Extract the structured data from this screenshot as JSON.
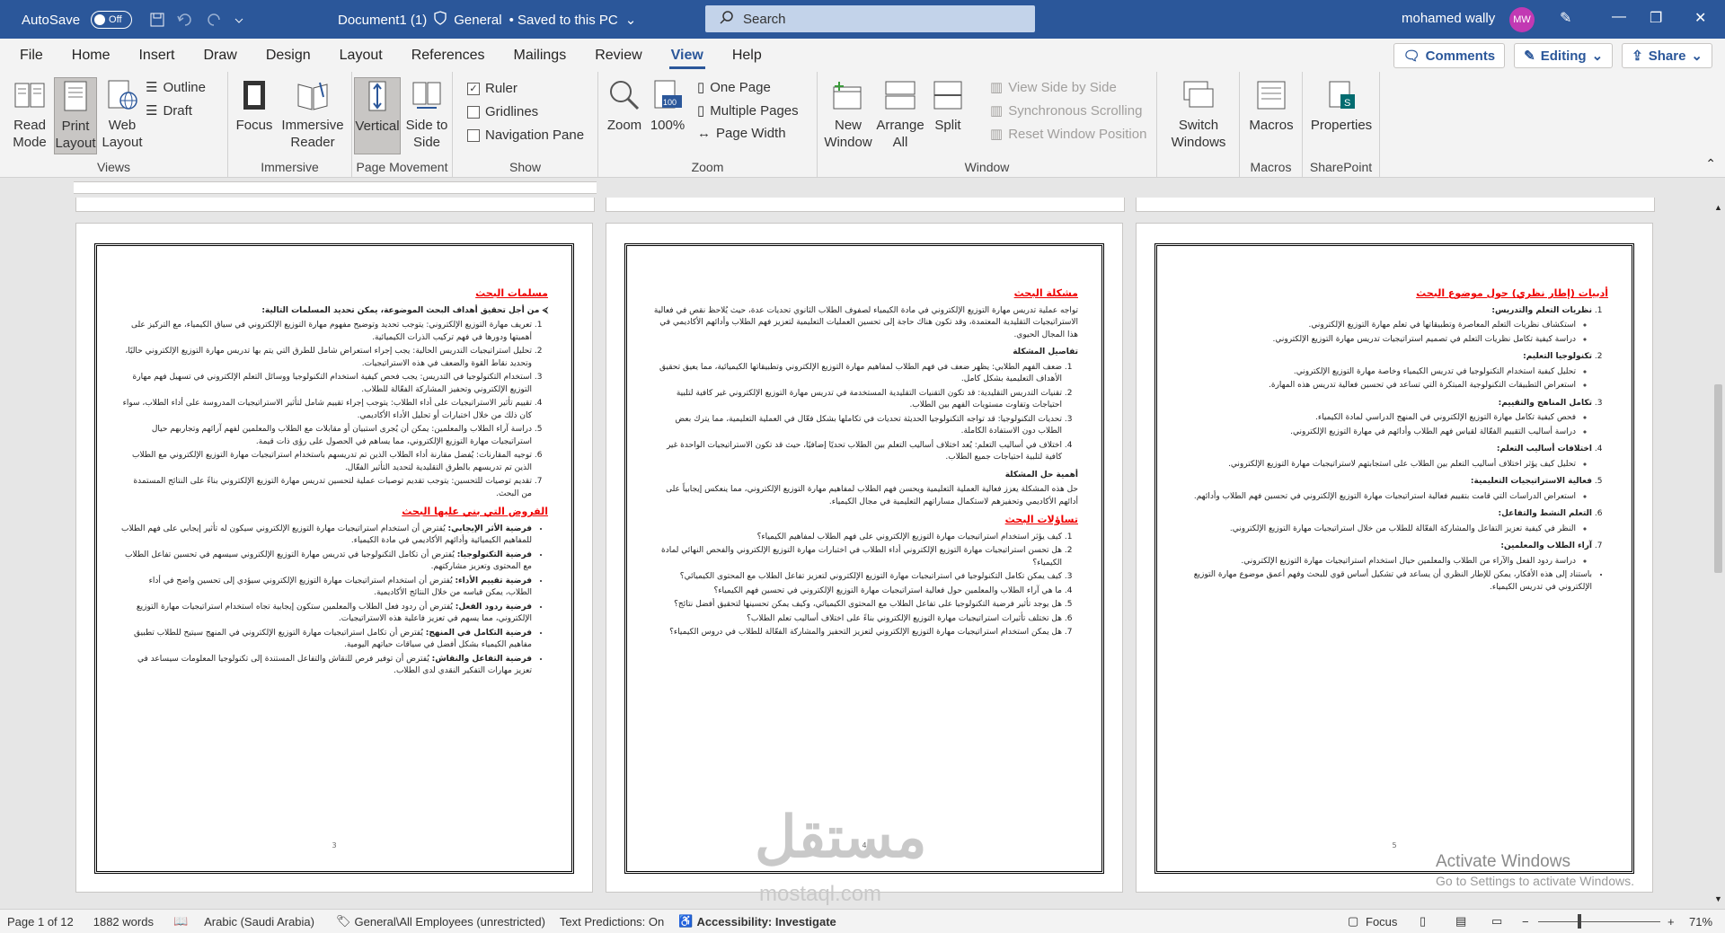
{
  "titlebar": {
    "autosave_label": "AutoSave",
    "autosave_state": "Off",
    "doc_title": "Document1 (1)",
    "sensitivity": "General",
    "save_state": "• Saved to this PC",
    "search_placeholder": "Search",
    "user_name": "mohamed wally",
    "user_initials": "MW"
  },
  "menu": {
    "tabs": [
      "File",
      "Home",
      "Insert",
      "Draw",
      "Design",
      "Layout",
      "References",
      "Mailings",
      "Review",
      "View",
      "Help"
    ],
    "active_tab": "View",
    "comments_label": "Comments",
    "editing_label": "Editing",
    "share_label": "Share"
  },
  "ribbon": {
    "views": {
      "label": "Views",
      "read_mode": "Read Mode",
      "print_layout": "Print Layout",
      "web_layout": "Web Layout",
      "outline": "Outline",
      "draft": "Draft"
    },
    "immersive": {
      "label": "Immersive",
      "focus": "Focus",
      "immersive_reader": "Immersive Reader"
    },
    "page_movement": {
      "label": "Page Movement",
      "vertical": "Vertical",
      "side_to_side": "Side to Side"
    },
    "show": {
      "label": "Show",
      "ruler": "Ruler",
      "gridlines": "Gridlines",
      "navigation_pane": "Navigation Pane",
      "ruler_checked": true
    },
    "zoom": {
      "label": "Zoom",
      "zoom": "Zoom",
      "hundred": "100%",
      "one_page": "One Page",
      "multiple_pages": "Multiple Pages",
      "page_width": "Page Width"
    },
    "window": {
      "label": "Window",
      "new_window": "New Window",
      "arrange_all": "Arrange All",
      "split": "Split",
      "view_side_by_side": "View Side by Side",
      "sync_scrolling": "Synchronous Scrolling",
      "reset_position": "Reset Window Position",
      "switch_windows": "Switch Windows"
    },
    "macros": {
      "label": "Macros",
      "macros": "Macros"
    },
    "sharepoint": {
      "label": "SharePoint",
      "properties": "Properties"
    }
  },
  "pages": {
    "p3": {
      "number": "3",
      "h1": "مسلمات البحث",
      "intro": "من أجل تحقيق أهداف البحث الموضوعة، يمكن تحديد المسلمات التالية:",
      "items": [
        "تعريف مهارة التوزيع الإلكتروني: يتوجب تحديد وتوضيح مفهوم مهارة التوزيع الإلكتروني في سياق الكيمياء، مع التركيز على أهميتها ودورها في فهم تركيب الذرات الكيميائية.",
        "تحليل استراتيجيات التدريس الحالية: يجب إجراء استعراض شامل للطرق التي يتم بها تدريس مهارة التوزيع الإلكتروني حاليًا، وتحديد نقاط القوة والضعف في هذه الاستراتيجيات.",
        "استخدام التكنولوجيا في التدريس: يجب فحص كيفية استخدام التكنولوجيا ووسائل التعلم الإلكتروني في تسهيل فهم مهارة التوزيع الإلكتروني وتحفيز المشاركة الفعّالة للطلاب.",
        "تقييم تأثير الاستراتيجيات على أداء الطلاب: يتوجب إجراء تقييم شامل لتأثير الاستراتيجيات المدروسة على أداء الطلاب، سواء كان ذلك من خلال اختبارات أو تحليل الأداء الأكاديمي.",
        "دراسة آراء الطلاب والمعلمين: يمكن أن يُجرى استبيان أو مقابلات مع الطلاب والمعلمين لفهم آرائهم وتجاربهم حيال استراتيجيات مهارة التوزيع الإلكتروني، مما يساهم في الحصول على رؤى ذات قيمة.",
        "توجيه المقارنات: يُفضل مقارنة أداء الطلاب الذين تم تدريسهم باستخدام استراتيجيات مهارة التوزيع الإلكتروني مع الطلاب الذين تم تدريسهم بالطرق التقليدية لتحديد التأثير الفعّال.",
        "تقديم توصيات للتحسين: يتوجب تقديم توصيات عملية لتحسين تدريس مهارة التوزيع الإلكتروني بناءً على النتائج المستمدة من البحث."
      ],
      "h2": "الفروض التي بني عليها البحث",
      "hyp": [
        {
          "b": "فرضية الأثر الإيجابي:",
          "t": " يُفترض أن استخدام استراتيجيات مهارة التوزيع الإلكتروني سيكون له تأثير إيجابي على فهم الطلاب للمفاهيم الكيميائية وأدائهم الأكاديمي في مادة الكيمياء."
        },
        {
          "b": "فرضية التكنولوجيا:",
          "t": " يُفترض أن تكامل التكنولوجيا في تدريس مهارة التوزيع الإلكتروني سيسهم في تحسين تفاعل الطلاب مع المحتوى وتعزيز مشاركتهم."
        },
        {
          "b": "فرضية تقييم الأداء:",
          "t": " يُفترض أن استخدام استراتيجيات مهارة التوزيع الإلكتروني سيؤدي إلى تحسين واضح في أداء الطلاب، يمكن قياسه من خلال النتائج الأكاديمية."
        },
        {
          "b": "فرضية ردود الفعل:",
          "t": " يُفترض أن ردود فعل الطلاب والمعلمين ستكون إيجابية تجاه استخدام استراتيجيات مهارة التوزيع الإلكتروني، مما يسهم في تعزيز فاعلية هذه الاستراتيجيات."
        },
        {
          "b": "فرضية التكامل في المنهج:",
          "t": " يُفترض أن تكامل استراتيجيات مهارة التوزيع الإلكتروني في المنهج سيتيح للطلاب تطبيق مفاهيم الكيمياء بشكل أفضل في سياقات حياتهم اليومية."
        },
        {
          "b": "فرضية التفاعل والنقاش:",
          "t": " يُفترض أن توفير فرص للنقاش والتفاعل المستندة إلى تكنولوجيا المعلومات سيساعد في تعزيز مهارات التفكير النقدي لدى الطلاب."
        }
      ]
    },
    "p4": {
      "number": "4",
      "h1": "مشكلة البحث",
      "intro": "تواجه عملية تدريس مهارة التوزيع الإلكتروني في مادة الكيمياء لصفوف الطلاب الثانوي تحديات عدة، حيث يُلاحظ نقص في فعالية الاستراتيجيات التقليدية المعتمدة، وقد تكون هناك حاجة إلى تحسين العمليات التعليمية لتعزيز فهم الطلاب وأدائهم الأكاديمي في هذا المجال الحيوي.",
      "sh1": "تفاصيل المشكلة",
      "items": [
        "ضعف الفهم الطلابي: يظهر ضعف في فهم الطلاب لمفاهيم مهارة التوزيع الإلكتروني وتطبيقاتها الكيميائية، مما يعيق تحقيق الأهداف التعليمية بشكل كامل.",
        "تقنيات التدريس التقليدية: قد تكون التقنيات التقليدية المستخدمة في تدريس مهارة التوزيع الإلكتروني غير كافية لتلبية احتياجات وتفاوت مستويات الفهم بين الطلاب.",
        "تحديات التكنولوجيا: قد تواجه التكنولوجيا الحديثة تحديات في تكاملها بشكل فعّال في العملية التعليمية، مما يترك بعض الطلاب دون الاستفادة الكاملة.",
        "اختلاف في أساليب التعلم: يُعد اختلاف أساليب التعلم بين الطلاب تحديًا إضافيًا، حيث قد تكون الاستراتيجيات الواحدة غير كافية لتلبية احتياجات جميع الطلاب."
      ],
      "sh2": "أهمية حل المشكلة",
      "importance": "حل هذه المشكلة يعزز فعالية العملية التعليمية ويحسن فهم الطلاب لمفاهيم مهارة التوزيع الإلكتروني، مما ينعكس إيجابياً على أدائهم الأكاديمي وتحفيزهم لاستكمال مساراتهم التعليمية في مجال الكيمياء.",
      "h2": "تساؤلات البحث",
      "questions": [
        "كيف يؤثر استخدام استراتيجيات مهارة التوزيع الإلكتروني على فهم الطلاب لمفاهيم الكيمياء؟",
        "هل تحسن استراتيجيات مهارة التوزيع الإلكتروني أداء الطلاب في اختبارات مهارة التوزيع الإلكتروني والفحص النهائي لمادة الكيمياء؟",
        "كيف يمكن تكامل التكنولوجيا في استراتيجيات مهارة التوزيع الإلكتروني لتعزيز تفاعل الطلاب مع المحتوى الكيميائي؟",
        "ما هي آراء الطلاب والمعلمين حول فعالية استراتيجيات مهارة التوزيع الإلكتروني في تحسين فهم الكيمياء؟",
        "هل يوجد تأثير فرضية التكنولوجيا على تفاعل الطلاب مع المحتوى الكيميائي، وكيف يمكن تحسينها لتحقيق أفضل نتائج؟",
        "هل تختلف تأثيرات استراتيجيات مهارة التوزيع الإلكتروني بناءً على اختلاف أساليب تعلم الطلاب؟",
        "هل يمكن استخدام استراتيجيات مهارة التوزيع الإلكتروني لتعزيز التحفيز والمشاركة الفعّالة للطلاب في دروس الكيمياء؟"
      ]
    },
    "p5": {
      "number": "5",
      "h1": "أدبيات (إطار نظري) حول موضوع البحث",
      "sections": [
        {
          "t": "نظريات التعلم والتدريس:",
          "b": [
            "استكشاف نظريات التعلم المعاصرة وتطبيقاتها في تعلم مهارة التوزيع الإلكتروني.",
            "دراسة كيفية تكامل نظريات التعلم في تصميم استراتيجيات تدريس مهارة التوزيع الإلكتروني."
          ]
        },
        {
          "t": "تكنولوجيا التعليم:",
          "b": [
            "تحليل كيفية استخدام التكنولوجيا في تدريس الكيمياء وخاصة مهارة التوزيع الإلكتروني.",
            "استعراض التطبيقات التكنولوجية المبتكرة التي تساعد في تحسين فعالية تدريس هذه المهارة."
          ]
        },
        {
          "t": "تكامل المناهج والتقييم:",
          "b": [
            "فحص كيفية تكامل مهارة التوزيع الإلكتروني في المنهج الدراسي لمادة الكيمياء.",
            "دراسة أساليب التقييم الفعّالة لقياس فهم الطلاب وأدائهم في مهارة التوزيع الإلكتروني."
          ]
        },
        {
          "t": "اختلافات أساليب التعلم:",
          "b": [
            "تحليل كيف يؤثر اختلاف أساليب التعلم بين الطلاب على استجابتهم لاستراتيجيات مهارة التوزيع الإلكتروني."
          ]
        },
        {
          "t": "فعالية الاستراتيجيات التعليمية:",
          "b": [
            "استعراض الدراسات التي قامت بتقييم فعالية استراتيجيات مهارة التوزيع الإلكتروني في تحسين فهم الطلاب وأدائهم."
          ]
        },
        {
          "t": "التعلم النشط والتفاعل:",
          "b": [
            "النظر في كيفية تعزيز التفاعل والمشاركة الفعّالة للطلاب من خلال استراتيجيات مهارة التوزيع الإلكتروني."
          ]
        },
        {
          "t": "آراء الطلاب والمعلمين:",
          "b": [
            "دراسة ردود الفعل والآراء من الطلاب والمعلمين حيال استخدام استراتيجيات مهارة التوزيع الإلكتروني."
          ]
        }
      ],
      "closing": "باستناد إلى هذه الأفكار، يمكن للإطار النظري أن يساعد في تشكيل أساس قوي للبحث وفهم أعمق موضوع مهارة التوزيع الإلكتروني في تدريس الكيمياء."
    }
  },
  "watermark": {
    "arabic": "مستقل",
    "latin": "mostaql.com"
  },
  "activate": {
    "title": "Activate Windows",
    "sub": "Go to Settings to activate Windows."
  },
  "status": {
    "page": "Page 1 of 12",
    "words": "1882 words",
    "language": "Arabic (Saudi Arabia)",
    "sensitivity": "General\\All Employees (unrestricted)",
    "predictions": "Text Predictions: On",
    "accessibility": "Accessibility: Investigate",
    "focus": "Focus",
    "zoom": "71%",
    "zoom_percent": 71
  },
  "colors": {
    "brand": "#2b579a",
    "heading_red": "#e00000",
    "avatar": "#c239b3"
  }
}
